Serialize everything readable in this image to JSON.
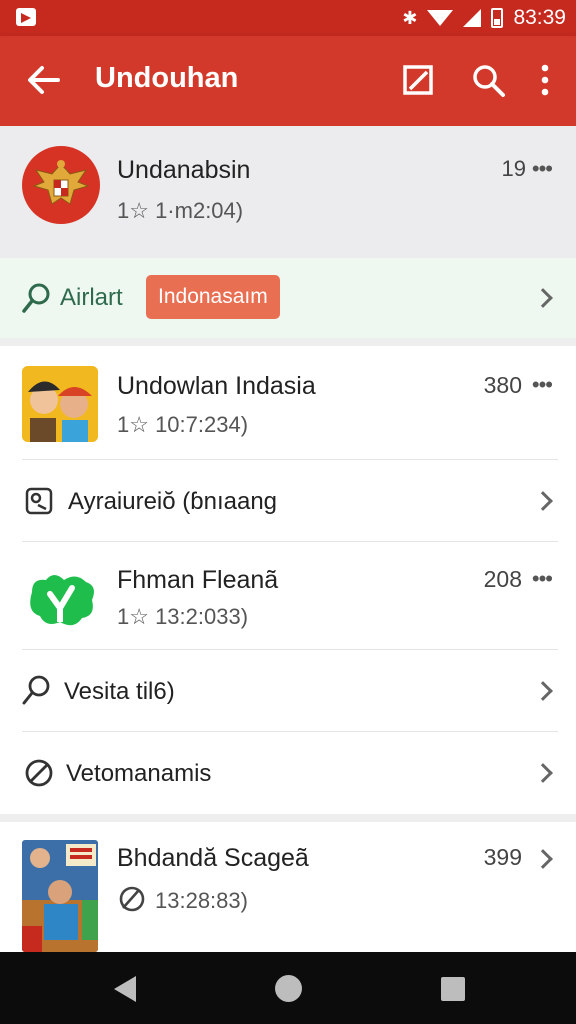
{
  "status_bar": {
    "time": "83:39",
    "bluetooth_icon": "bluetooth-icon",
    "wifi_icon": "wifi-icon",
    "signal_icon": "signal-icon",
    "battery_icon": "battery-icon"
  },
  "app_bar": {
    "title": "Undouhan",
    "back_icon": "arrow-back-icon",
    "edit_icon": "edit-square-icon",
    "search_icon": "search-icon",
    "more_icon": "more-vert-icon"
  },
  "header": {
    "title": "Undanabsin",
    "subtitle": "1☆ 1·m2:04)",
    "count": "19",
    "more": "•••"
  },
  "filter": {
    "label": "Airlart",
    "chip": "Indonasaım"
  },
  "list": {
    "item1": {
      "title": "Undowlan Indasia",
      "subtitle": "1☆ 10:7:234)",
      "count": "380",
      "more": "•••"
    },
    "item2": {
      "label": "Ayraiureiŏ (ɓnıaang"
    },
    "item3": {
      "title": "Fhman Fleanã",
      "subtitle": "1☆ 13:2:033)",
      "count": "208",
      "more": "•••"
    },
    "item4": {
      "label": "Vesita til6)"
    },
    "item5": {
      "label": "Vetomanamis"
    },
    "item6": {
      "title": "Bhdandă Scageã",
      "subtitle": "13:28:83)",
      "count": "399"
    }
  },
  "colors": {
    "status_bar": "#c62a1f",
    "app_bar": "#d2392b",
    "chip": "#e96f53",
    "filter_bg": "#eef8f0",
    "header_bg": "#ececee"
  }
}
